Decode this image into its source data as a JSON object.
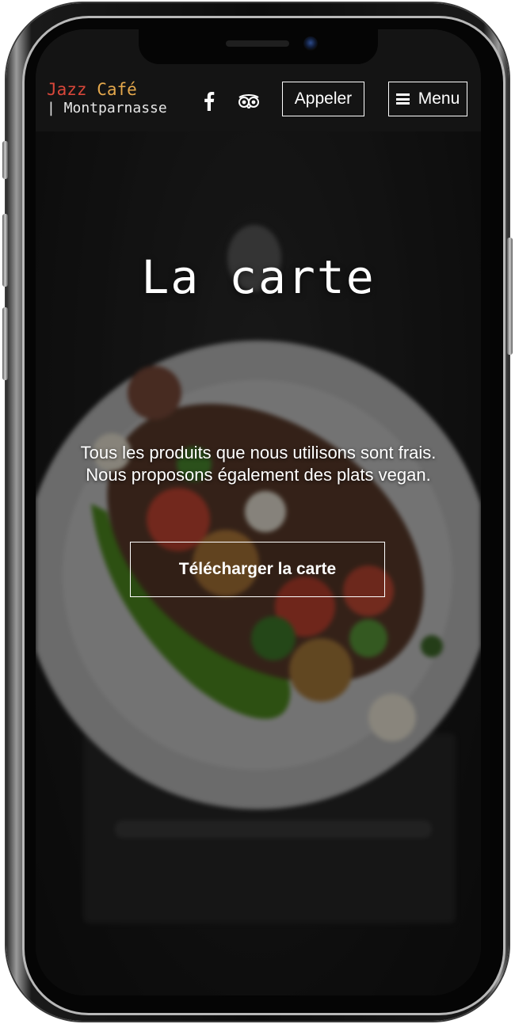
{
  "header": {
    "brand_primary_word": "Jazz",
    "brand_secondary_word": "Café",
    "brand_subtitle": "| Montparnasse",
    "social_icons": [
      "facebook-icon",
      "tripadvisor-icon"
    ],
    "call_button_label": "Appeler",
    "menu_button_label": "Menu",
    "menu_icon": "hamburger-icon"
  },
  "hero": {
    "title": "La carte",
    "description_line1": "Tous les produits que nous utilisons sont frais.",
    "description_line2": "Nous proposons également des plats vegan.",
    "download_button_label": "Télécharger la carte"
  },
  "colors": {
    "brand_red": "#d9473a",
    "brand_gold": "#e5a84c",
    "navbar_bg": "#141414",
    "text_white": "#ffffff"
  }
}
